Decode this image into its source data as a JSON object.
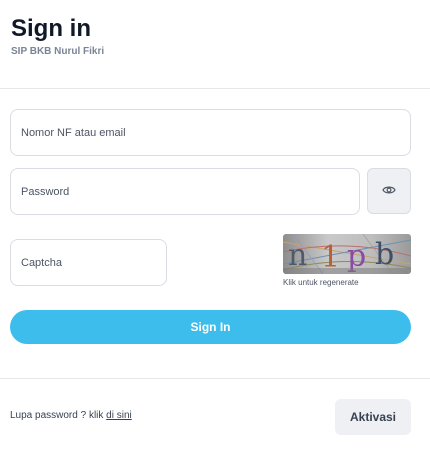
{
  "header": {
    "title": "Sign in",
    "subtitle": "SIP BKB Nurul Fikri"
  },
  "form": {
    "identity_placeholder": "Nomor NF atau email",
    "password_placeholder": "Password",
    "password_toggle_icon": "eye-icon",
    "captcha_placeholder": "Captcha",
    "captcha_hint": "Klik untuk regenerate",
    "submit_label": "Sign In"
  },
  "footer": {
    "forgot_prefix": "Lupa password ? klik ",
    "forgot_link": "di sini",
    "activate_label": "Aktivasi"
  },
  "colors": {
    "primary": "#3dbdeb",
    "secondary_button": "#eef0f4",
    "border": "#d9dde3"
  }
}
